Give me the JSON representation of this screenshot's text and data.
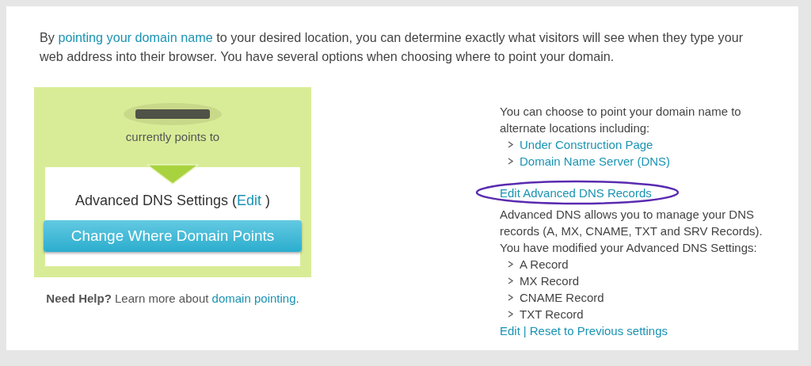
{
  "intro": {
    "before": "By ",
    "link": "pointing your domain name",
    "after": " to your desired location, you can determine exactly what visitors will see when they type your web address into their browser. You have several options when choosing where to point your domain."
  },
  "status_card": {
    "points_text": "currently points to",
    "setting": "Advanced DNS Settings",
    "edit_open": "(",
    "edit_link": "Edit",
    "edit_close": " )",
    "button": "Change Where Domain Points"
  },
  "help": {
    "bold": "Need Help?",
    "text": " Learn more about ",
    "link": "domain pointing",
    "end": "."
  },
  "options": {
    "intro": "You can choose to point your domain name to alternate locations including:",
    "links": [
      "Under Construction Page",
      "Domain Name Server (DNS)"
    ],
    "advanced_link": "Edit Advanced DNS Records",
    "advanced_text": "Advanced DNS allows you to manage your DNS records (A, MX, CNAME, TXT and SRV Records).",
    "modified_text": "You have modified your Advanced DNS Settings:",
    "records": [
      "A Record",
      "MX Record",
      "CNAME Record",
      "TXT Record"
    ],
    "footer_links": [
      {
        "kind": "link",
        "label": "Edit"
      },
      {
        "kind": "separator",
        "label": "|"
      },
      {
        "kind": "link",
        "label": "Reset to Previous settings"
      }
    ]
  }
}
